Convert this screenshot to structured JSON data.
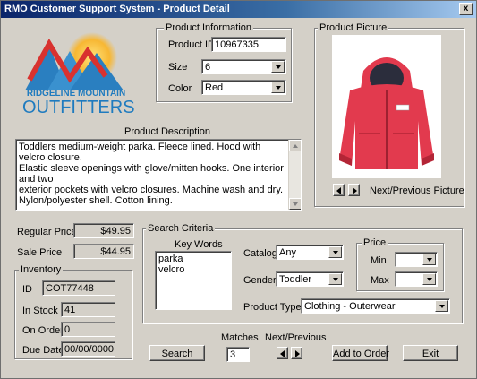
{
  "window": {
    "title": "RMO Customer Support System - Product Detail",
    "close_glyph": "x"
  },
  "logo": {
    "line1": "RIDGELINE MOUNTAIN",
    "line2": "OUTFITTERS"
  },
  "product_info": {
    "group_label": "Product Information",
    "product_id_label": "Product ID",
    "product_id_value": "10967335",
    "size_label": "Size",
    "size_value": "6",
    "color_label": "Color",
    "color_value": "Red"
  },
  "product_picture": {
    "group_label": "Product Picture",
    "nav_label": "Next/Previous Picture"
  },
  "description": {
    "label": "Product Description",
    "lines": [
      "Toddlers medium-weight parka. Fleece lined. Hood with velcro closure.",
      "Elastic sleeve openings with glove/mitten hooks. One interior and two",
      "exterior pockets with velcro closures. Machine wash and dry.",
      "Nylon/polyester shell. Cotton lining."
    ]
  },
  "pricing": {
    "regular_label": "Regular Price",
    "regular_value": "$49.95",
    "sale_label": "Sale Price",
    "sale_value": "$44.95"
  },
  "inventory": {
    "group_label": "Inventory",
    "id_label": "ID",
    "id_value": "COT77448",
    "in_stock_label": "In Stock",
    "in_stock_value": "41",
    "on_order_label": "On Order",
    "on_order_value": "0",
    "due_date_label": "Due Date",
    "due_date_value": "00/00/0000"
  },
  "search_criteria": {
    "group_label": "Search Criteria",
    "keywords_label": "Key Words",
    "keywords": [
      "parka",
      "velcro"
    ],
    "catalog_label": "Catalog",
    "catalog_value": "Any",
    "gender_label": "Gender",
    "gender_value": "Toddler",
    "price_group_label": "Price",
    "min_label": "Min",
    "min_value": "",
    "max_label": "Max",
    "max_value": "",
    "product_type_label": "Product Type",
    "product_type_value": "Clothing - Outerwear"
  },
  "bottom": {
    "search_button": "Search",
    "matches_label": "Matches",
    "matches_value": "3",
    "next_previous_label": "Next/Previous",
    "add_to_order_button": "Add to Order",
    "exit_button": "Exit"
  },
  "colors": {
    "window_bg": "#d4d0c8",
    "title_bar": "#0a246a",
    "logo_blue": "#1f7bbf",
    "logo_red": "#d8322f",
    "jacket_red": "#e23a4e"
  }
}
